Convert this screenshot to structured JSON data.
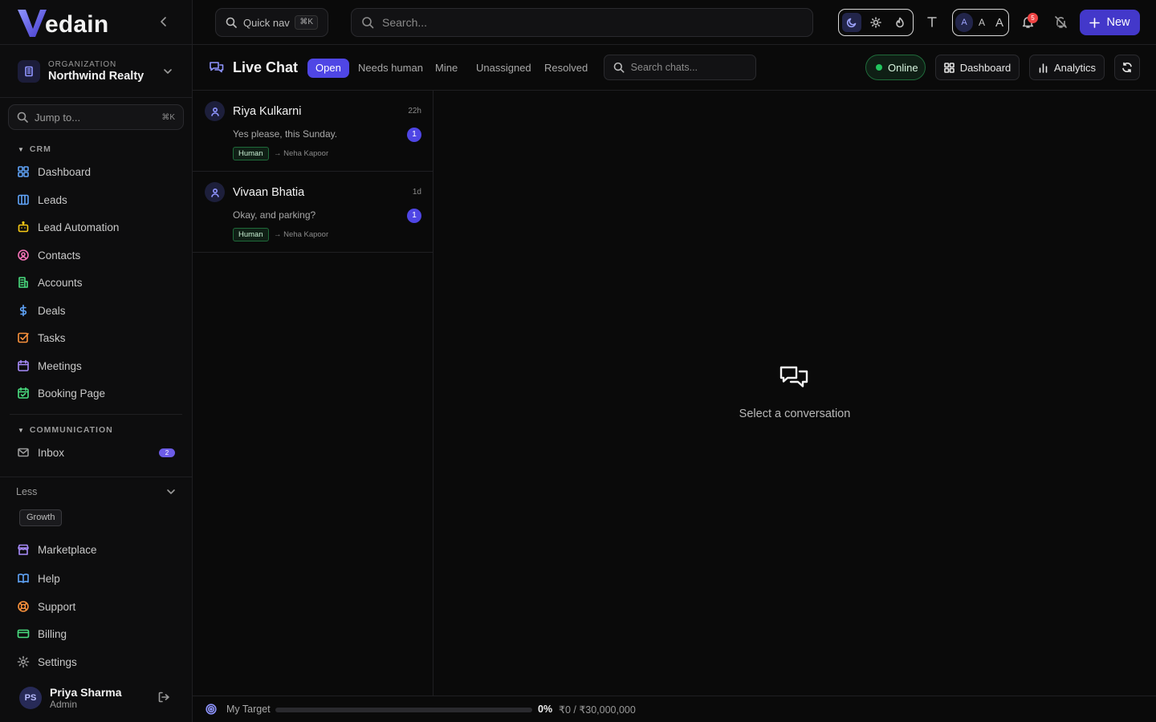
{
  "brand": {
    "logo_letter": "V",
    "name": "edain"
  },
  "organization": {
    "caption": "ORGANIZATION",
    "name": "Northwind Realty"
  },
  "sidebar": {
    "jump_placeholder": "Jump to...",
    "jump_shortcut": "⌘K",
    "sections": [
      {
        "title": "CRM",
        "items": [
          {
            "label": "Dashboard",
            "icon": "grid-icon",
            "color": "#60a5fa"
          },
          {
            "label": "Leads",
            "icon": "columns-icon",
            "color": "#60a5fa"
          },
          {
            "label": "Lead Automation",
            "icon": "bot-icon",
            "color": "#facc15"
          },
          {
            "label": "Contacts",
            "icon": "contact-icon",
            "color": "#f472b6"
          },
          {
            "label": "Accounts",
            "icon": "building-icon",
            "color": "#4ade80"
          },
          {
            "label": "Deals",
            "icon": "dollar-icon",
            "color": "#60a5fa"
          },
          {
            "label": "Tasks",
            "icon": "checkbox-icon",
            "color": "#fb923c"
          },
          {
            "label": "Meetings",
            "icon": "calendar-icon",
            "color": "#a78bfa"
          },
          {
            "label": "Booking Page",
            "icon": "calendar-check-icon",
            "color": "#4ade80"
          }
        ]
      },
      {
        "title": "COMMUNICATION",
        "items": [
          {
            "label": "Inbox",
            "icon": "mail-icon",
            "color": "#9a9a9a",
            "badge": "2"
          }
        ]
      }
    ],
    "less_label": "Less",
    "plan_badge": "Growth",
    "bottom_items": [
      {
        "label": "Marketplace",
        "icon": "store-icon",
        "color": "#a78bfa"
      },
      {
        "label": "Help",
        "icon": "book-icon",
        "color": "#60a5fa"
      },
      {
        "label": "Support",
        "icon": "lifebuoy-icon",
        "color": "#fb923c"
      },
      {
        "label": "Billing",
        "icon": "card-icon",
        "color": "#4ade80"
      },
      {
        "label": "Settings",
        "icon": "gear-icon",
        "color": "#9a9a9a"
      }
    ],
    "user": {
      "initials": "PS",
      "name": "Priya Sharma",
      "role": "Admin"
    }
  },
  "topbar": {
    "quicknav_label": "Quick nav",
    "quicknav_shortcut": "⌘K",
    "search_placeholder": "Search...",
    "theme_options": [
      "moon-icon",
      "sun-icon",
      "flame-icon"
    ],
    "font_sizes": [
      "A",
      "A",
      "A"
    ],
    "notification_count": "5",
    "new_label": "New",
    "accent": "#4338ca"
  },
  "chat": {
    "title": "Live Chat",
    "tabs": [
      "Open",
      "Needs human",
      "Mine",
      "Unassigned",
      "Resolved"
    ],
    "active_tab": "Open",
    "search_placeholder": "Search chats...",
    "status": "Online",
    "dashboard_label": "Dashboard",
    "analytics_label": "Analytics",
    "conversations": [
      {
        "name": "Riya Kulkarni",
        "time": "22h",
        "message": "Yes please, this Sunday.",
        "unread": "1",
        "tag": "Human",
        "assignee": "→ Neha Kapoor"
      },
      {
        "name": "Vivaan Bhatia",
        "time": "1d",
        "message": "Okay, and parking?",
        "unread": "1",
        "tag": "Human",
        "assignee": "→ Neha Kapoor"
      }
    ],
    "empty_state": "Select a conversation"
  },
  "target": {
    "label": "My Target",
    "progress_fraction": 0,
    "percent": "0%",
    "amount": "₹0 / ₹30,000,000"
  }
}
